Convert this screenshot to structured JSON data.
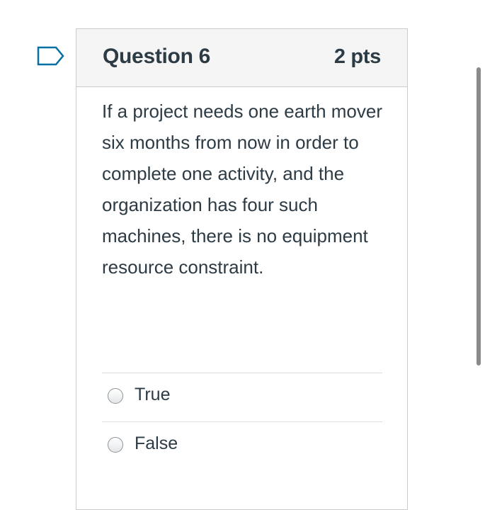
{
  "question": {
    "title": "Question 6",
    "points": "2 pts",
    "text": "If a project needs one earth mover six months from now in order to complete one activity, and the organization has four such machines, there is no equipment resource constraint.",
    "flag_icon": "bookmark-flag-icon",
    "options": [
      {
        "label": "True",
        "selected": false
      },
      {
        "label": "False",
        "selected": false
      }
    ]
  },
  "colors": {
    "text": "#2d3b45",
    "header_bg": "#f5f5f5",
    "border": "#c7cdd1",
    "flag": "#0770a3"
  }
}
